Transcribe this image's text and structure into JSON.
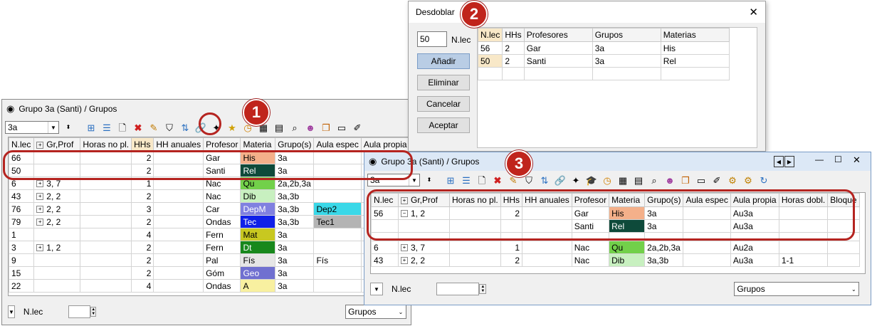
{
  "callouts": [
    "1",
    "2",
    "3"
  ],
  "window1": {
    "title": "Grupo 3a (Santi) / Grupos",
    "class_select": "3a",
    "columns": [
      "N.lec",
      "Gr,Prof",
      "Horas no pl.",
      "HHs",
      "HH anuales",
      "Profesor",
      "Materia",
      "Grupo(s)",
      "Aula espec",
      "Aula propia"
    ],
    "rows": [
      {
        "nlec": "66",
        "grprof": "",
        "hhs": "2",
        "prof": "Gar",
        "mat": "His",
        "matc": "#f4b08a",
        "grp": "3a",
        "aula": "",
        "aulac": ""
      },
      {
        "nlec": "50",
        "grprof": "",
        "hhs": "2",
        "prof": "Santi",
        "mat": "Rel",
        "matc": "#0e4a3a",
        "grp": "3a",
        "aula": "",
        "aulac": ""
      },
      {
        "nlec": "6",
        "grprof": "3, 7",
        "hhs": "1",
        "prof": "Nac",
        "mat": "Qu",
        "matc": "#72d04a",
        "grp": "2a,2b,3a",
        "aula": "",
        "aulac": ""
      },
      {
        "nlec": "43",
        "grprof": "2, 2",
        "hhs": "2",
        "prof": "Nac",
        "mat": "Dib",
        "matc": "#c8f0c0",
        "grp": "3a,3b",
        "aula": "",
        "aulac": ""
      },
      {
        "nlec": "76",
        "grprof": "2, 2",
        "hhs": "3",
        "prof": "Car",
        "mat": "DepM",
        "matc": "#8080e0",
        "grp": "3a,3b",
        "aula": "Dep2",
        "aulac": "#3ad8e8"
      },
      {
        "nlec": "79",
        "grprof": "2, 2",
        "hhs": "2",
        "prof": "Ondas",
        "mat": "Tec",
        "matc": "#1020e8",
        "grp": "3a,3b",
        "aula": "Tec1",
        "aulac": "#b4b4b4"
      },
      {
        "nlec": "1",
        "grprof": "",
        "hhs": "4",
        "prof": "Fern",
        "mat": "Mat",
        "matc": "#c8c820",
        "grp": "3a",
        "aula": "",
        "aulac": ""
      },
      {
        "nlec": "3",
        "grprof": "1, 2",
        "hhs": "2",
        "prof": "Fern",
        "mat": "Dt",
        "matc": "#18881c",
        "grp": "3a",
        "aula": "",
        "aulac": ""
      },
      {
        "nlec": "9",
        "grprof": "",
        "hhs": "2",
        "prof": "Pal",
        "mat": "Fís",
        "matc": "#e6e6e6",
        "grp": "3a",
        "aula": "Fís",
        "aulac": ""
      },
      {
        "nlec": "15",
        "grprof": "",
        "hhs": "2",
        "prof": "Góm",
        "mat": "Geo",
        "matc": "#7070d0",
        "grp": "3a",
        "aula": "",
        "aulac": ""
      },
      {
        "nlec": "22",
        "grprof": "",
        "hhs": "4",
        "prof": "Ondas",
        "mat": "A",
        "matc": "#f8f0a0",
        "grp": "3a",
        "aula": "",
        "aulac": ""
      }
    ],
    "status_label": "N.lec",
    "view_select": "Grupos"
  },
  "dialog": {
    "title": "Desdoblar",
    "nlec_value": "50",
    "nlec_label": "N.lec",
    "buttons": {
      "add": "Añadir",
      "delete": "Eliminar",
      "cancel": "Cancelar",
      "accept": "Aceptar"
    },
    "columns": [
      "N.lec",
      "HHs",
      "Profesores",
      "Grupos",
      "Materias"
    ],
    "rows": [
      {
        "nlec": "56",
        "hhs": "2",
        "prof": "Gar",
        "grp": "3a",
        "mat": "His"
      },
      {
        "nlec": "50",
        "hhs": "2",
        "prof": "Santi",
        "grp": "3a",
        "mat": "Rel"
      }
    ]
  },
  "window3": {
    "title": "Grupo 3a (Santi) / Grupos",
    "class_select": "3a",
    "columns": [
      "N.lec",
      "Gr,Prof",
      "Horas no pl.",
      "HHs",
      "HH anuales",
      "Profesor",
      "Materia",
      "Grupo(s)",
      "Aula espec",
      "Aula propia",
      "Horas dobl.",
      "Bloque"
    ],
    "rows": [
      {
        "nlec": "56",
        "grprof": "1, 2",
        "hhs": "2",
        "prof": "Gar",
        "mat": "His",
        "matc": "#f4b08a",
        "grp": "3a",
        "aulap": "Au3a",
        "hd": ""
      },
      {
        "nlec": "",
        "grprof": "",
        "hhs": "",
        "prof": "Santi",
        "mat": "Rel",
        "matc": "#0e4a3a",
        "grp": "3a",
        "aulap": "Au3a",
        "hd": ""
      },
      {
        "nlec": "6",
        "grprof": "3, 7",
        "hhs": "1",
        "prof": "Nac",
        "mat": "Qu",
        "matc": "#72d04a",
        "grp": "2a,2b,3a",
        "aulap": "Au2a",
        "hd": ""
      },
      {
        "nlec": "43",
        "grprof": "2, 2",
        "hhs": "2",
        "prof": "Nac",
        "mat": "Dib",
        "matc": "#c8f0c0",
        "grp": "3a,3b",
        "aulap": "Au3a",
        "hd": "1-1"
      }
    ],
    "status_label": "N.lec",
    "view_select": "Grupos"
  }
}
